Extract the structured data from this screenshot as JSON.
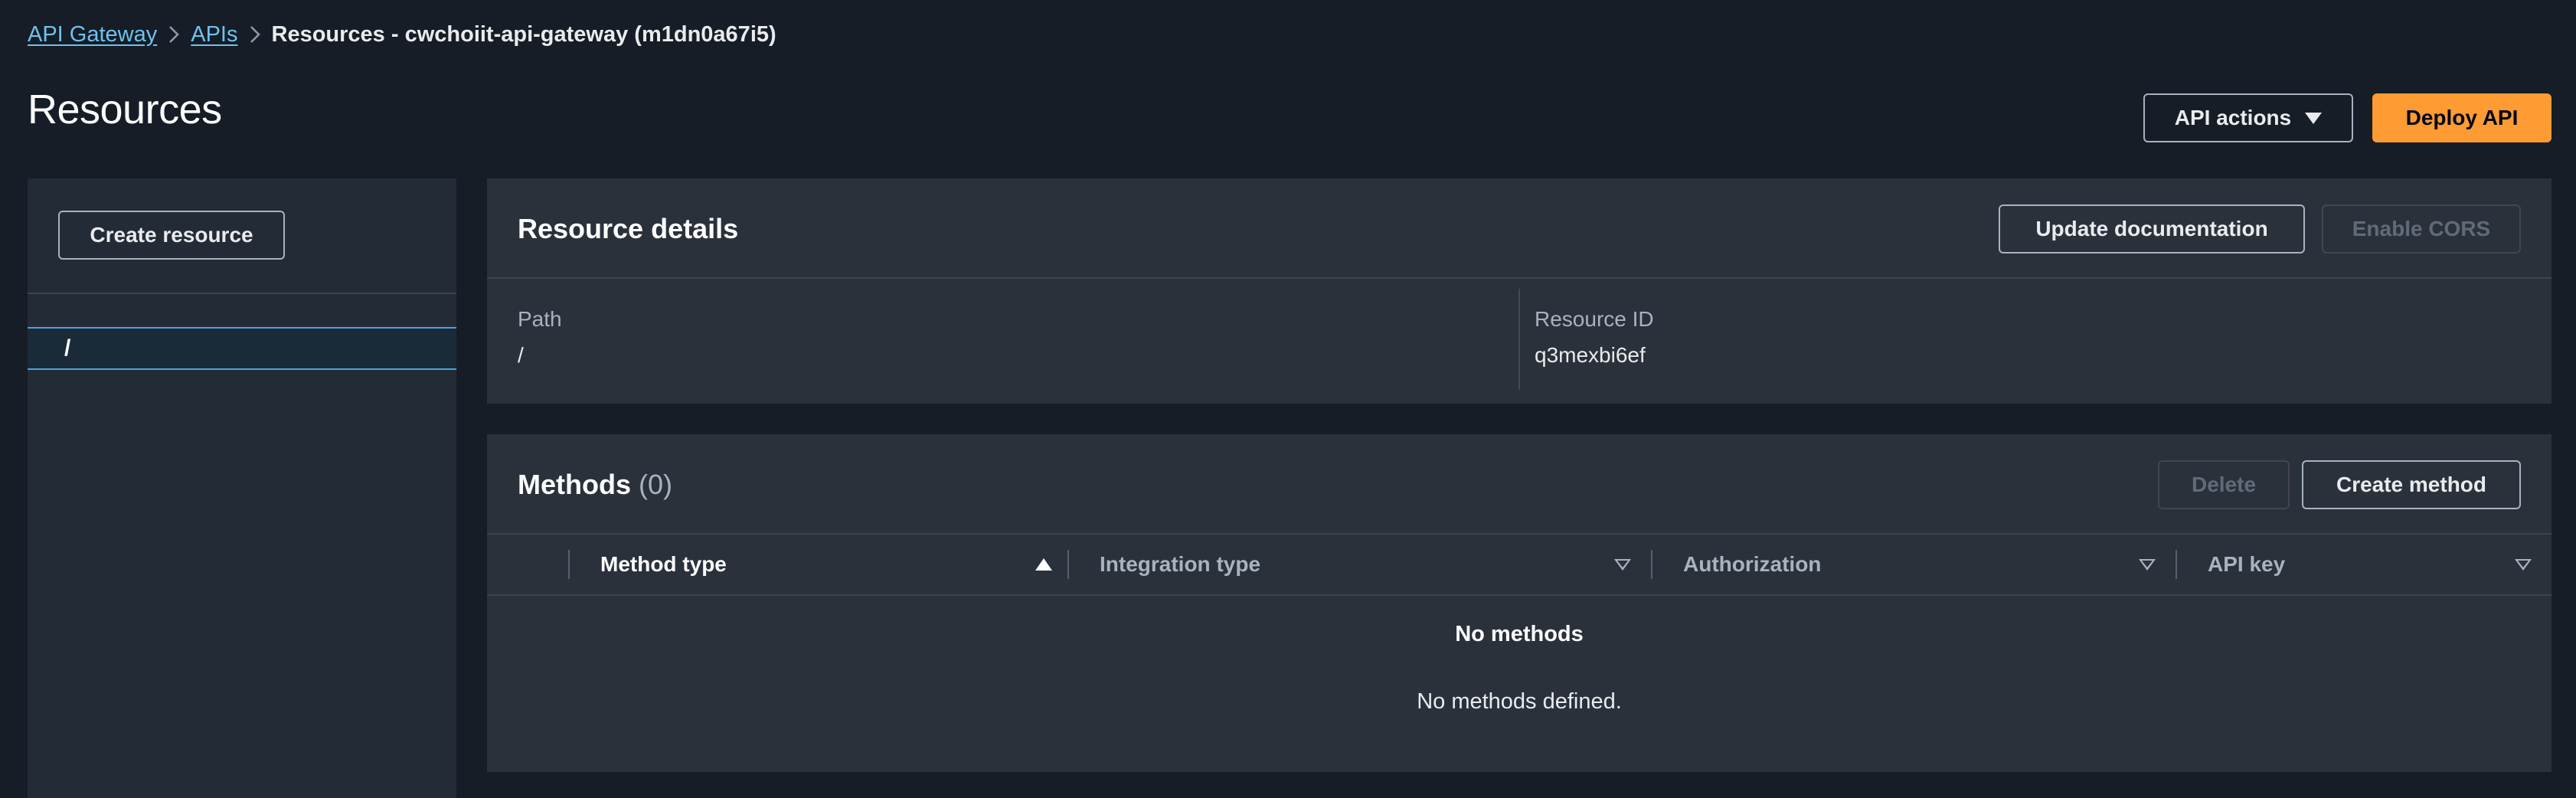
{
  "breadcrumb": {
    "items": [
      "API Gateway",
      "APIs"
    ],
    "current": "Resources - cwchoiit-api-gateway (m1dn0a67i5)"
  },
  "page": {
    "title": "Resources",
    "api_actions_label": "API actions",
    "deploy_api_label": "Deploy API"
  },
  "tree": {
    "create_resource_label": "Create resource",
    "items": [
      {
        "path": "/",
        "selected": true
      }
    ]
  },
  "resource_details": {
    "title": "Resource details",
    "update_documentation_label": "Update documentation",
    "enable_cors_label": "Enable CORS",
    "path_label": "Path",
    "path_value": "/",
    "resource_id_label": "Resource ID",
    "resource_id_value": "q3mexbi6ef"
  },
  "methods": {
    "title": "Methods",
    "count": "(0)",
    "delete_label": "Delete",
    "create_method_label": "Create method",
    "columns": [
      "Method type",
      "Integration type",
      "Authorization",
      "API key"
    ],
    "empty_title": "No methods",
    "empty_description": "No methods defined."
  },
  "colors": {
    "background": "#161d26",
    "panel": "#2a313b",
    "link": "#6fc1ed",
    "primary": "#ff9b33",
    "selection_border": "#41a6e0"
  }
}
